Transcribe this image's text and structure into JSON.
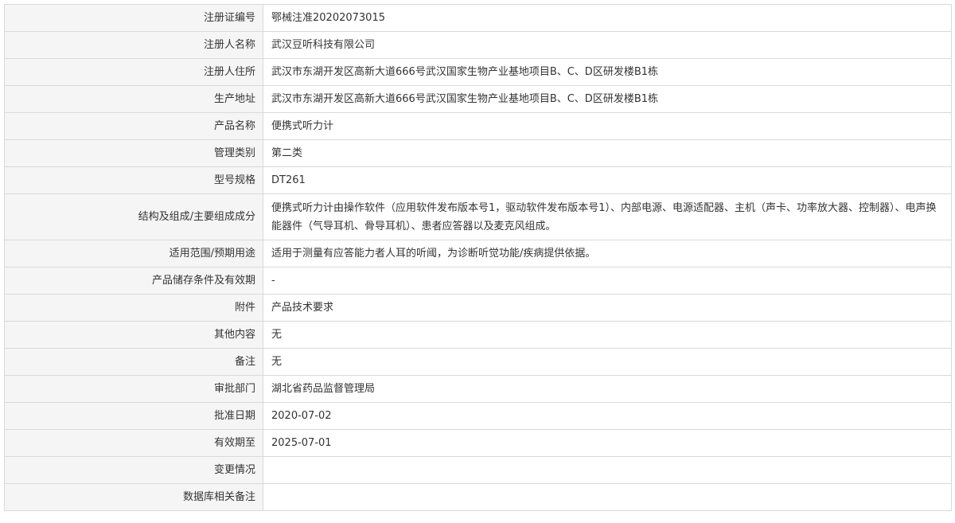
{
  "rows": [
    {
      "label": "注册证编号",
      "value": "鄂械注准20202073015"
    },
    {
      "label": "注册人名称",
      "value": "武汉豆听科技有限公司"
    },
    {
      "label": "注册人住所",
      "value": "武汉市东湖开发区高新大道666号武汉国家生物产业基地项目B、C、D区研发楼B1栋"
    },
    {
      "label": "生产地址",
      "value": "武汉市东湖开发区高新大道666号武汉国家生物产业基地项目B、C、D区研发楼B1栋"
    },
    {
      "label": "产品名称",
      "value": "便携式听力计"
    },
    {
      "label": "管理类别",
      "value": "第二类"
    },
    {
      "label": "型号规格",
      "value": "DT261"
    },
    {
      "label": "结构及组成/主要组成成分",
      "value": "便携式听力计由操作软件（应用软件发布版本号1，驱动软件发布版本号1）、内部电源、电源适配器、主机（声卡、功率放大器、控制器）、电声换能器件（气导耳机、骨导耳机）、患者应答器以及麦克风组成。"
    },
    {
      "label": "适用范围/预期用途",
      "value": "适用于测量有应答能力者人耳的听阈，为诊断听觉功能/疾病提供依据。"
    },
    {
      "label": "产品储存条件及有效期",
      "value": "-"
    },
    {
      "label": "附件",
      "value": "产品技术要求"
    },
    {
      "label": "其他内容",
      "value": "无"
    },
    {
      "label": "备注",
      "value": "无"
    },
    {
      "label": "审批部门",
      "value": "湖北省药品监督管理局"
    },
    {
      "label": "批准日期",
      "value": "2020-07-02"
    },
    {
      "label": "有效期至",
      "value": "2025-07-01"
    },
    {
      "label": "变更情况",
      "value": ""
    },
    {
      "label": "数据库相关备注",
      "value": ""
    }
  ]
}
